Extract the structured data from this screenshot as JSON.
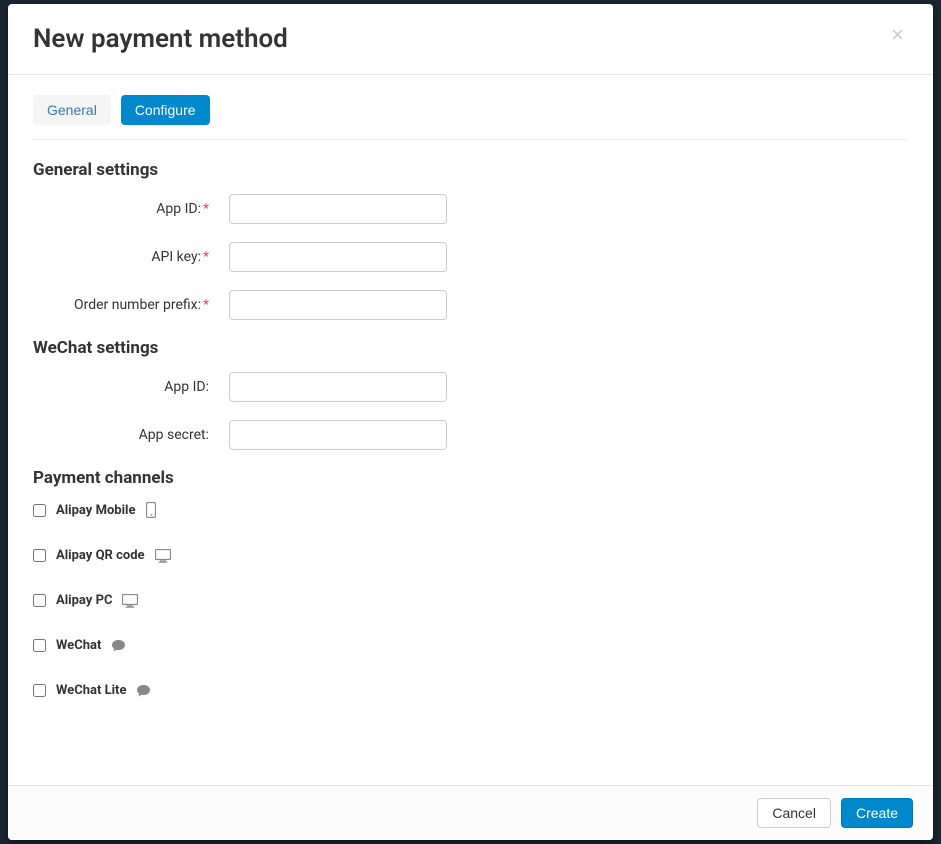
{
  "modal": {
    "title": "New payment method",
    "tabs": {
      "general": "General",
      "configure": "Configure"
    },
    "sections": {
      "general_settings": {
        "heading": "General settings",
        "app_id_label": "App ID:",
        "api_key_label": "API key:",
        "order_prefix_label": "Order number prefix:"
      },
      "wechat_settings": {
        "heading": "WeChat settings",
        "app_id_label": "App ID:",
        "app_secret_label": "App secret:"
      },
      "payment_channels": {
        "heading": "Payment channels",
        "items": [
          {
            "label": "Alipay Mobile",
            "icon": "mobile"
          },
          {
            "label": "Alipay QR code",
            "icon": "desktop"
          },
          {
            "label": "Alipay PC",
            "icon": "desktop"
          },
          {
            "label": "WeChat",
            "icon": "chat"
          },
          {
            "label": "WeChat Lite",
            "icon": "chat"
          }
        ]
      }
    },
    "footer": {
      "cancel": "Cancel",
      "create": "Create"
    }
  }
}
